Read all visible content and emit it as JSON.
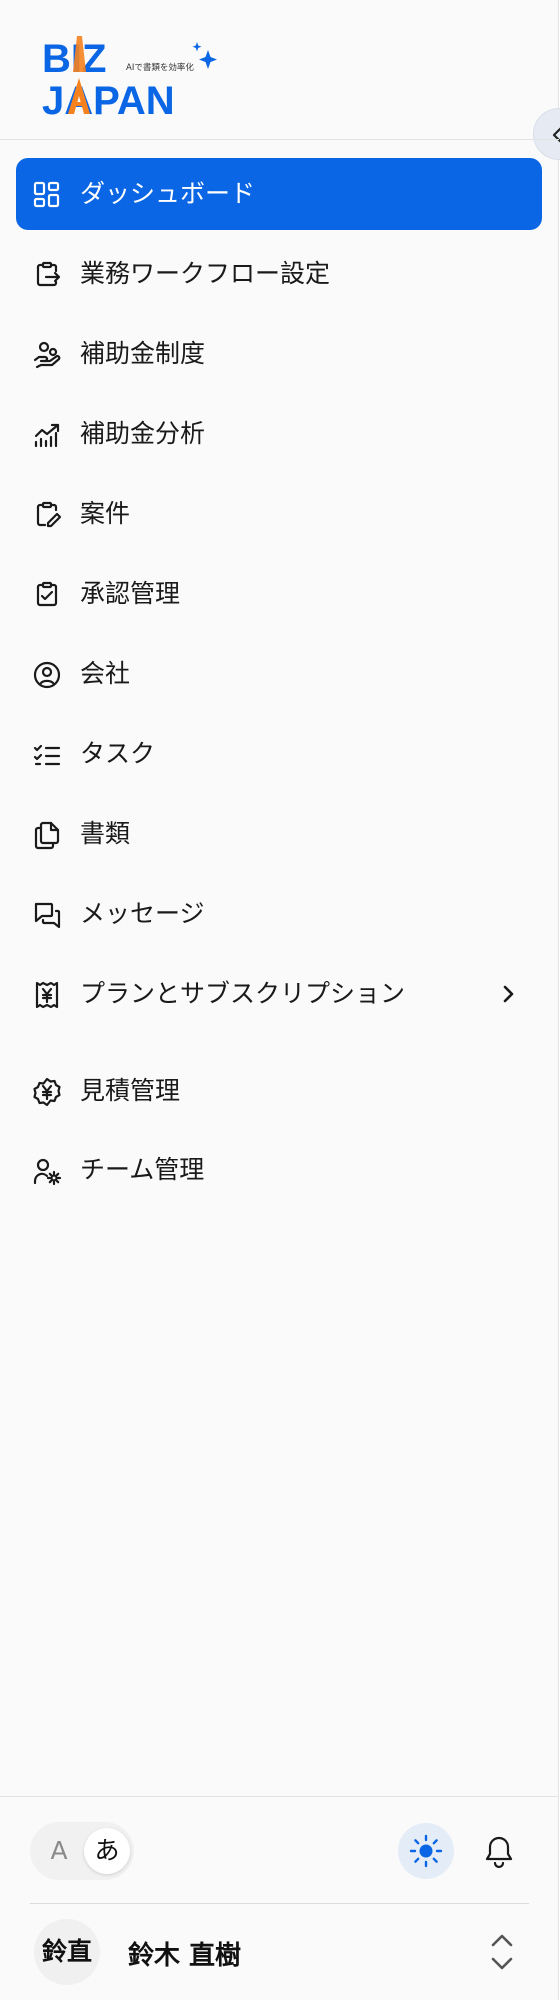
{
  "brand": {
    "logo_line1": "BIZ",
    "logo_line2": "JAPAN",
    "tagline": "AIで書類を効率化",
    "primary_color": "#0a66e4",
    "accent_color": "#f5821f"
  },
  "sidebar": {
    "items": [
      {
        "label": "ダッシュボード",
        "icon": "dashboard-grid-icon",
        "active": true
      },
      {
        "label": "業務ワークフロー設定",
        "icon": "clipboard-export-icon",
        "active": false
      },
      {
        "label": "補助金制度",
        "icon": "hand-coins-icon",
        "active": false
      },
      {
        "label": "補助金分析",
        "icon": "chart-trend-icon",
        "active": false
      },
      {
        "label": "案件",
        "icon": "clipboard-pencil-icon",
        "active": false
      },
      {
        "label": "承認管理",
        "icon": "clipboard-check-icon",
        "active": false
      },
      {
        "label": "会社",
        "icon": "user-circle-icon",
        "active": false
      },
      {
        "label": "タスク",
        "icon": "checklist-icon",
        "active": false
      },
      {
        "label": "書類",
        "icon": "documents-icon",
        "active": false
      },
      {
        "label": "メッセージ",
        "icon": "chat-bubbles-icon",
        "active": false
      },
      {
        "label": "プランとサブスクリプション",
        "icon": "receipt-yen-icon",
        "active": false,
        "has_submenu": true
      },
      {
        "label": "見積管理",
        "icon": "yen-badge-icon",
        "active": false
      },
      {
        "label": "チーム管理",
        "icon": "user-gear-icon",
        "active": false
      }
    ]
  },
  "footer": {
    "lang_options": [
      "A",
      "あ"
    ],
    "selected_lang": "あ",
    "user": {
      "initials": "鈴直",
      "name": "鈴木 直樹"
    }
  }
}
